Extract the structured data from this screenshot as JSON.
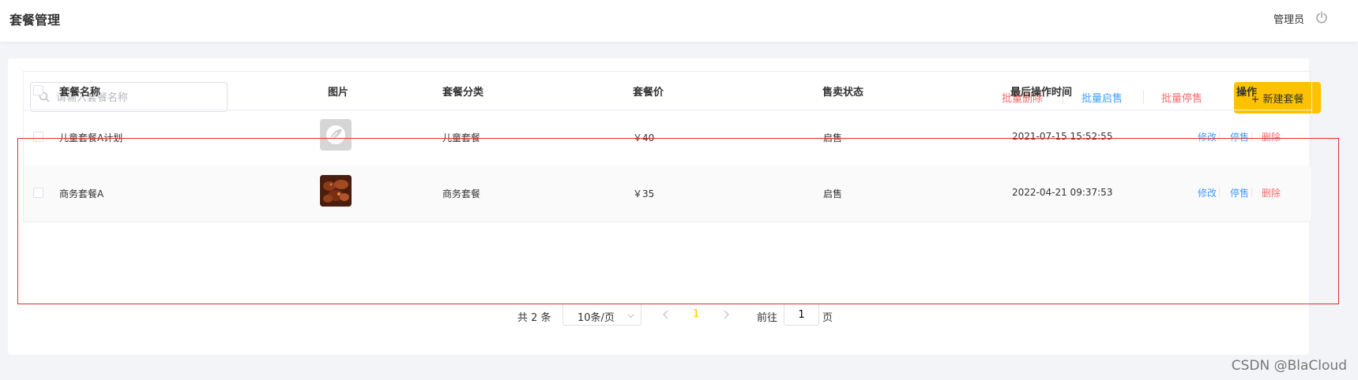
{
  "header": {
    "title": "套餐管理",
    "user": "管理员"
  },
  "toolbar": {
    "search_placeholder": "请输入套餐名称",
    "batch_delete": "批量删除",
    "batch_enable": "批量启售",
    "batch_disable": "批量停售",
    "new_button": "+ 新建套餐"
  },
  "table": {
    "columns": [
      "套餐名称",
      "图片",
      "套餐分类",
      "套餐价",
      "售卖状态",
      "最后操作时间",
      "操作"
    ],
    "rows": [
      {
        "name": "儿童套餐A计划",
        "image": "placeholder-logo",
        "category": "儿童套餐",
        "price": "￥40",
        "status": "启售",
        "updated": "2021-07-15 15:52:55"
      },
      {
        "name": "商务套餐A",
        "image": "braised-meat-photo",
        "category": "商务套餐",
        "price": "￥35",
        "status": "启售",
        "updated": "2022-04-21 09:37:53"
      }
    ],
    "actions": {
      "edit": "修改",
      "disable": "停售",
      "delete": "删除"
    }
  },
  "pagination": {
    "total": "共 2 条",
    "page_size": "10条/页",
    "current_page": "1",
    "goto_label": "前往",
    "goto_value": "1",
    "page_unit": "页"
  },
  "watermark": "CSDN @BlaCloud",
  "colors": {
    "accent": "#ffc200",
    "link_blue": "#419eff",
    "danger_red": "#f56c6c",
    "frame_red": "#e03030"
  }
}
